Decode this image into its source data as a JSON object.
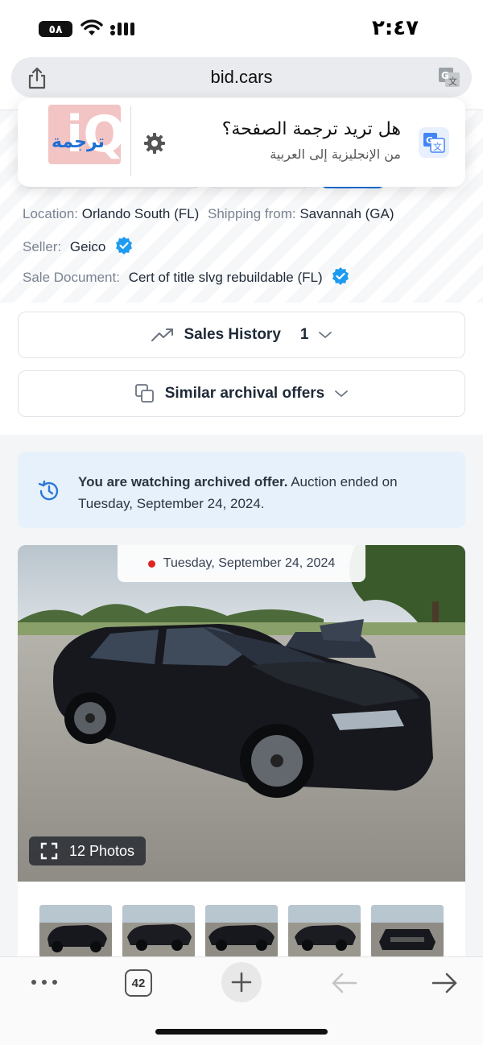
{
  "status_bar": {
    "battery": "٥٨",
    "time": "٢:٤٧"
  },
  "browser": {
    "url": "bid.cars"
  },
  "translate_popup": {
    "logo_text": "ترجمة",
    "question": "هل تريد ترجمة الصفحة؟",
    "languages": "من الإنجليزية إلى العربية"
  },
  "details": {
    "location_label": "Location:",
    "location_value": "Orlando South (FL)",
    "shipping_label": "Shipping from:",
    "shipping_value": "Savannah (GA)",
    "seller_label": "Seller:",
    "seller_value": "Geico",
    "sale_doc_label": "Sale Document:",
    "sale_doc_value": "Cert of title slvg rebuildable (FL)"
  },
  "sales_history": {
    "label": "Sales History",
    "count": "1"
  },
  "similar_offers": {
    "label": "Similar archival offers"
  },
  "notice": {
    "bold": "You are watching archived offer.",
    "rest": " Auction ended on Tuesday, September 24, 2024."
  },
  "photo": {
    "date": "Tuesday, September 24, 2024",
    "photos_count_label": "12 Photos"
  },
  "toolbar": {
    "tabs_count": "42"
  },
  "colors": {
    "accent_blue": "#1d9bf0",
    "notice_bg": "#e6f1fb",
    "dot_red": "#e02424"
  }
}
